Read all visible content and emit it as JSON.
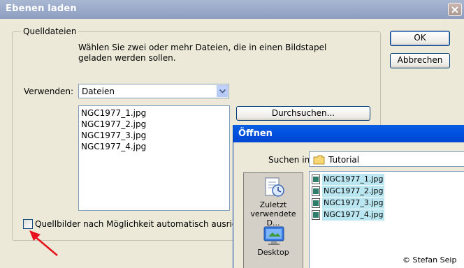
{
  "main_dialog": {
    "title": "Ebenen laden",
    "group_label": "Quelldateien",
    "instruction_line1": "Wählen Sie zwei oder mehr Dateien, die in einen Bildstapel",
    "instruction_line2": "geladen werden sollen.",
    "use_label": "Verwenden:",
    "use_value": "Dateien",
    "files": [
      "NGC1977_1.jpg",
      "NGC1977_2.jpg",
      "NGC1977_3.jpg",
      "NGC1977_4.jpg"
    ],
    "browse_button": "Durchsuchen...",
    "auto_align_label": "Quellbilder nach Möglichkeit automatisch ausrichten",
    "ok_button": "OK",
    "cancel_button": "Abbrechen"
  },
  "open_dialog": {
    "title": "Öffnen",
    "look_in_label": "Suchen in:",
    "look_in_value": "Tutorial",
    "places": [
      {
        "label_line1": "Zuletzt",
        "label_line2": "verwendete D...",
        "icon": "recent-documents-icon"
      },
      {
        "label_line1": "Desktop",
        "label_line2": "",
        "icon": "desktop-icon"
      }
    ],
    "files": [
      "NGC1977_1.jpg",
      "NGC1977_2.jpg",
      "NGC1977_3.jpg",
      "NGC1977_4.jpg"
    ]
  },
  "credit": "© Stefan Seip",
  "colors": {
    "dialog_bg": "#ece9d8",
    "inactive_title": "#a9b7d2",
    "active_title": "#0053e1",
    "selection": "#b9e6f0",
    "arrow": "#e8101c"
  }
}
